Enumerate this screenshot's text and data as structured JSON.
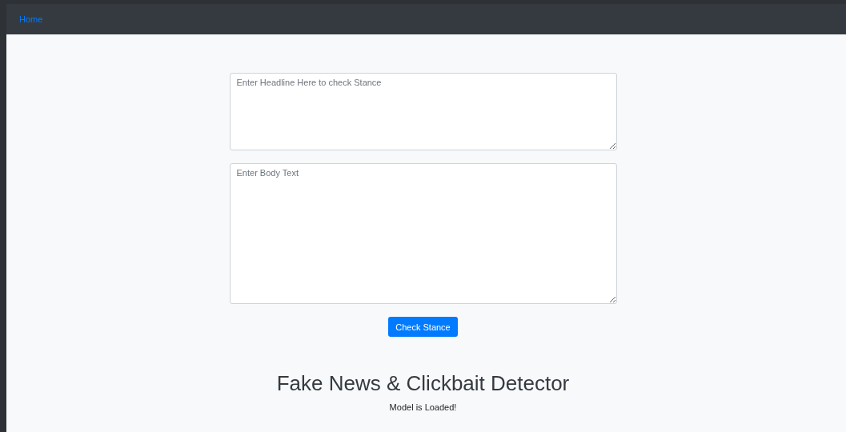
{
  "navbar": {
    "link": "Home"
  },
  "form": {
    "headline": {
      "placeholder": "Enter Headline Here to check Stance"
    },
    "body": {
      "placeholder": "Enter Body Text"
    },
    "button": "Check Stance"
  },
  "title": "Fake News & Clickbait Detector",
  "status": "Model is Loaded!"
}
